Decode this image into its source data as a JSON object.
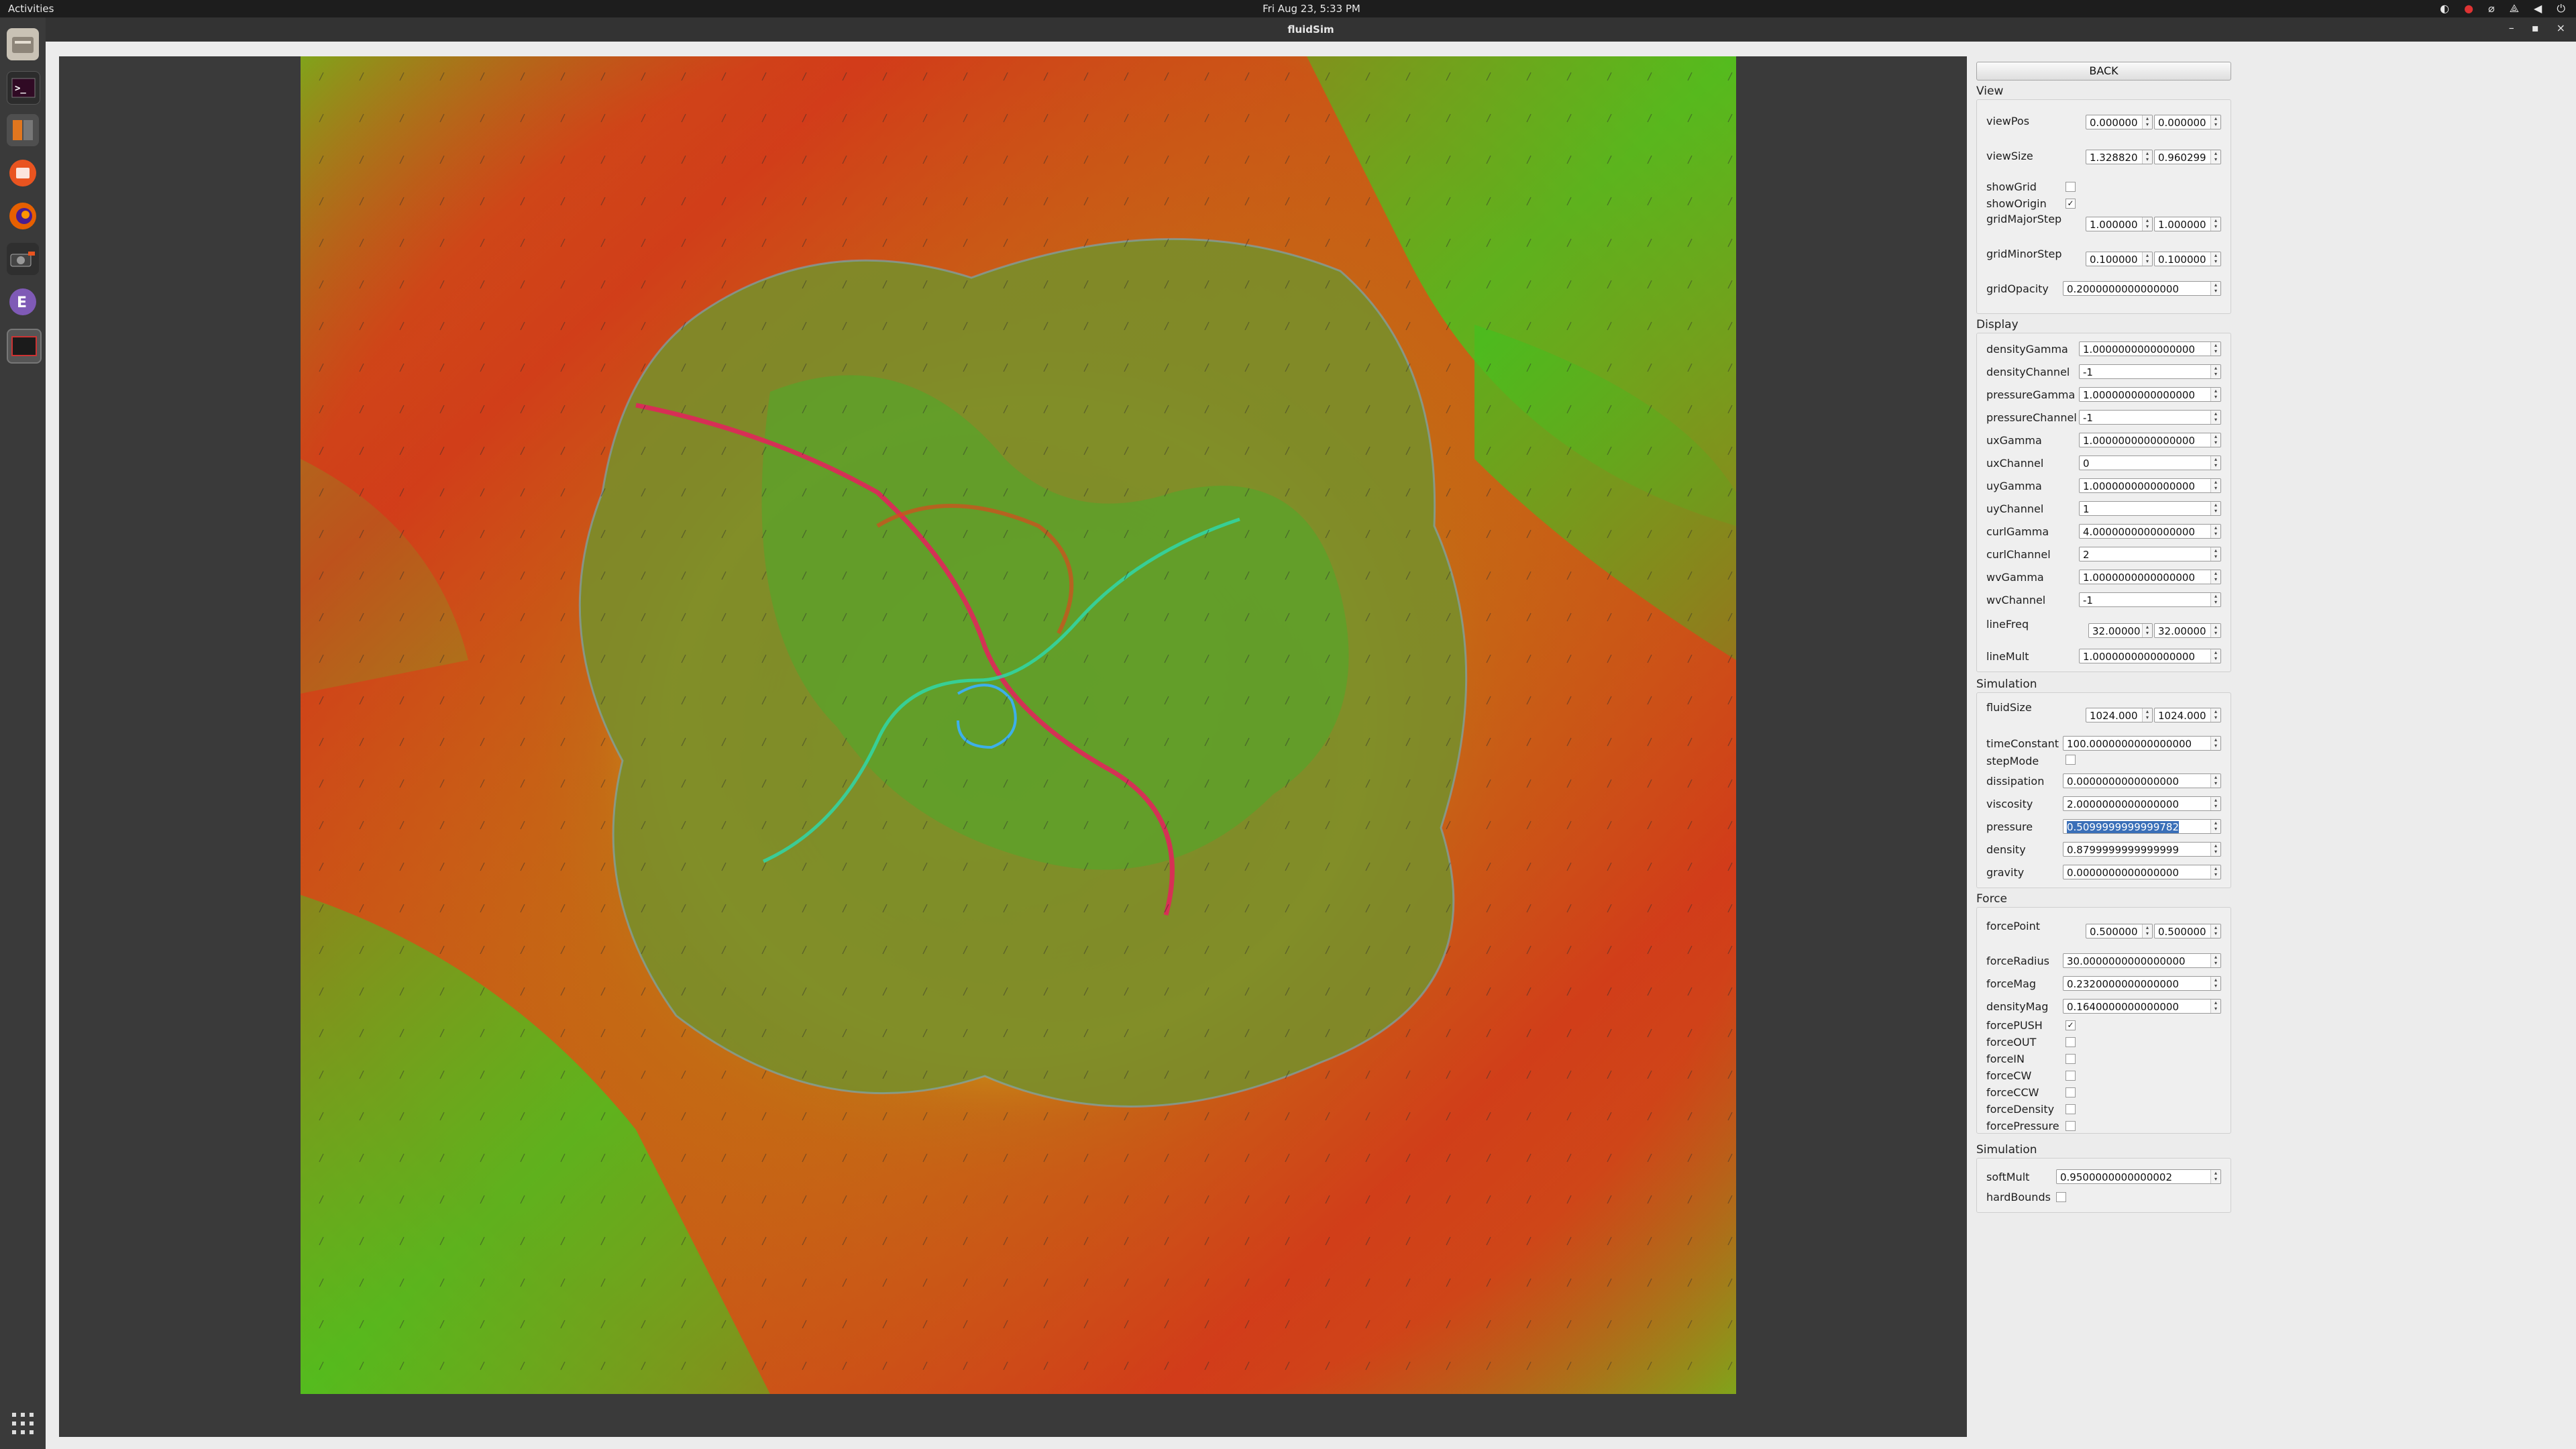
{
  "topbar": {
    "activities": "Activities",
    "clock": "Fri Aug 23, 5:33 PM"
  },
  "window": {
    "title": "fluidSim",
    "minimize_glyph": "–",
    "maximize_glyph": "▪",
    "close_glyph": "×"
  },
  "dock": {
    "items": [
      "files-icon",
      "terminal-icon",
      "software-updater-icon",
      "ubuntu-software-icon",
      "firefox-icon",
      "screenshot-tool-icon",
      "emacs-icon",
      "fluidsim-window-icon"
    ],
    "apps_grid_glyph": "⁞⁞⁞"
  },
  "panel": {
    "back_label": "BACK",
    "sections": {
      "view": "View",
      "display": "Display",
      "simulation": "Simulation",
      "force": "Force",
      "simulation2": "Simulation"
    },
    "view": {
      "viewPos": {
        "label": "viewPos",
        "a": "0.000000",
        "b": "0.000000"
      },
      "viewSize": {
        "label": "viewSize",
        "a": "1.328820",
        "b": "0.960299"
      },
      "showGrid": {
        "label": "showGrid",
        "checked": false
      },
      "showOrigin": {
        "label": "showOrigin",
        "checked": true
      },
      "gridMajorStep": {
        "label": "gridMajorStep",
        "a": "1.000000",
        "b": "1.000000"
      },
      "gridMinorStep": {
        "label": "gridMinorStep",
        "a": "0.100000",
        "b": "0.100000"
      },
      "gridOpacity": {
        "label": "gridOpacity",
        "value": "0.2000000000000000"
      }
    },
    "display": {
      "densityGamma": {
        "label": "densityGamma",
        "value": "1.0000000000000000"
      },
      "densityChannel": {
        "label": "densityChannel",
        "value": "-1"
      },
      "pressureGamma": {
        "label": "pressureGamma",
        "value": "1.0000000000000000"
      },
      "pressureChannel": {
        "label": "pressureChannel",
        "value": "-1"
      },
      "uxGamma": {
        "label": "uxGamma",
        "value": "1.0000000000000000"
      },
      "uxChannel": {
        "label": "uxChannel",
        "value": "0"
      },
      "uyGamma": {
        "label": "uyGamma",
        "value": "1.0000000000000000"
      },
      "uyChannel": {
        "label": "uyChannel",
        "value": "1"
      },
      "curlGamma": {
        "label": "curlGamma",
        "value": "4.0000000000000000"
      },
      "curlChannel": {
        "label": "curlChannel",
        "value": "2"
      },
      "wvGamma": {
        "label": "wvGamma",
        "value": "1.0000000000000000"
      },
      "wvChannel": {
        "label": "wvChannel",
        "value": "-1"
      },
      "lineFreq": {
        "label": "lineFreq",
        "a": "32.00000",
        "b": "32.00000"
      },
      "lineMult": {
        "label": "lineMult",
        "value": "1.0000000000000000"
      }
    },
    "simulation": {
      "fluidSize": {
        "label": "fluidSize",
        "a": "1024.000",
        "b": "1024.000"
      },
      "timeConstant": {
        "label": "timeConstant",
        "value": "100.0000000000000000"
      },
      "stepMode": {
        "label": "stepMode",
        "checked": false
      },
      "dissipation": {
        "label": "dissipation",
        "value": "0.0000000000000000"
      },
      "viscosity": {
        "label": "viscosity",
        "value": "2.0000000000000000"
      },
      "pressure": {
        "label": "pressure",
        "value": "0.5099999999999782"
      },
      "density": {
        "label": "density",
        "value": "0.8799999999999999"
      },
      "gravity": {
        "label": "gravity",
        "value": "0.0000000000000000"
      }
    },
    "force": {
      "forcePoint": {
        "label": "forcePoint",
        "a": "0.500000",
        "b": "0.500000"
      },
      "forceRadius": {
        "label": "forceRadius",
        "value": "30.0000000000000000"
      },
      "forceMag": {
        "label": "forceMag",
        "value": "0.2320000000000000"
      },
      "densityMag": {
        "label": "densityMag",
        "value": "0.1640000000000000"
      },
      "forcePUSH": {
        "label": "forcePUSH",
        "checked": true
      },
      "forceOUT": {
        "label": "forceOUT",
        "checked": false
      },
      "forceIN": {
        "label": "forceIN",
        "checked": false
      },
      "forceCW": {
        "label": "forceCW",
        "checked": false
      },
      "forceCCW": {
        "label": "forceCCW",
        "checked": false
      },
      "forceDensity": {
        "label": "forceDensity",
        "checked": false
      },
      "forcePressure": {
        "label": "forcePressure",
        "checked": false
      }
    },
    "simulation2": {
      "softMult": {
        "label": "softMult",
        "value": "0.9500000000000002"
      },
      "hardBounds": {
        "label": "hardBounds",
        "checked": false
      }
    }
  },
  "colors": {
    "panel_bg": "#ececec",
    "viewport_bg": "#3a3a3a",
    "selection": "#3a6fb8",
    "sim_green": "#3fbf22",
    "sim_red": "#d8261c",
    "sim_orange": "#c86a14"
  }
}
